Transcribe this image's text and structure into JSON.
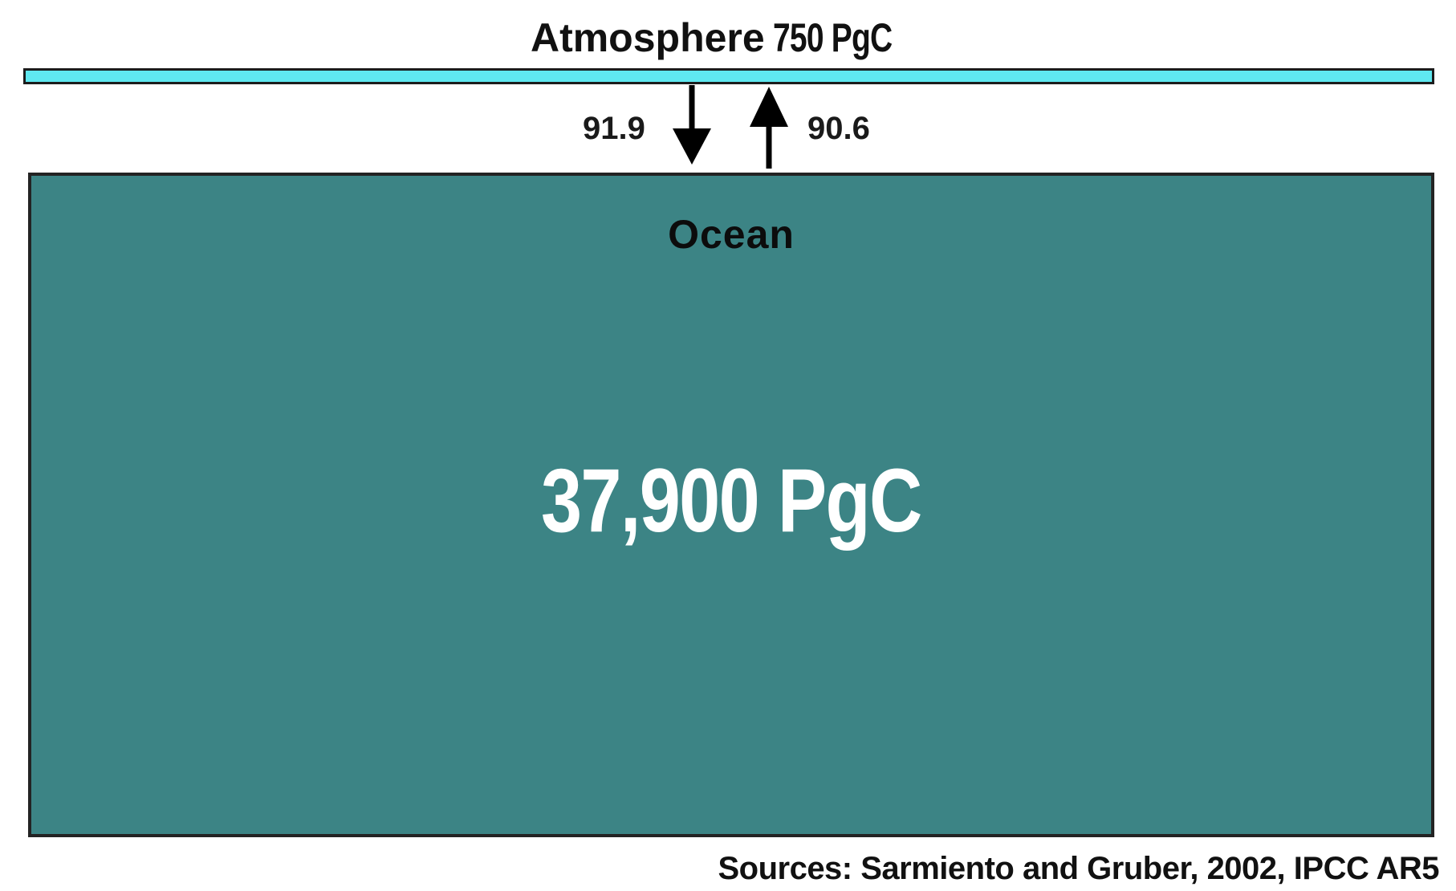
{
  "atmosphere": {
    "label": "Atmosphere",
    "value": "750 PgC",
    "color": "#5fe8f0"
  },
  "fluxes": {
    "down": "91.9",
    "up": "90.6"
  },
  "ocean": {
    "label": "Ocean",
    "value": "37,900 PgC",
    "color": "#3c8485"
  },
  "sources": "Sources: Sarmiento and Gruber, 2002, IPCC AR5"
}
